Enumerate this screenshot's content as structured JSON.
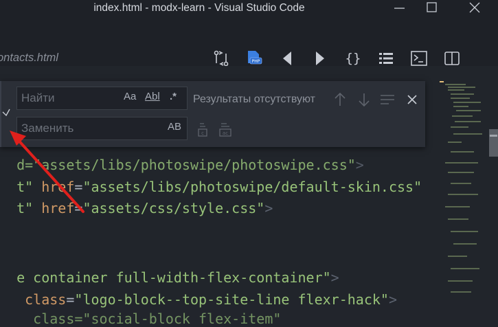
{
  "window": {
    "title": "index.html - modx-learn - Visual Studio Code"
  },
  "tab": {
    "label": "ontacts.html"
  },
  "toolbar": {
    "icons": [
      "compare-changes-icon",
      "php-icon",
      "previous-icon",
      "next-icon",
      "braces-icon",
      "list-icon",
      "terminal-icon",
      "split-editor-icon"
    ]
  },
  "find_widget": {
    "find_placeholder": "Найти",
    "replace_placeholder": "Заменить",
    "match_case": "Aa",
    "whole_word": "Abl",
    "regex": ".*",
    "preserve_case": "AB",
    "results": "Результаты отсутствуют"
  },
  "code_lines": [
    {
      "parts": [
        "t\" ",
        "href",
        "=",
        "\"assets/libs/photoswipe/default-skin.css\""
      ]
    },
    {
      "parts": [
        "t\" ",
        "href",
        "=",
        "\"assets/css/style.css\"",
        ">"
      ]
    },
    {
      "parts": [
        "e container full-width-flex-container\"",
        ">"
      ]
    },
    {
      "parts": [
        " ",
        "class",
        "=",
        "\"logo-block--top-site-line flexr-hack\"",
        ">"
      ]
    }
  ],
  "colors": {
    "background": "#21252b",
    "string": "#98c379",
    "attribute": "#d19a66",
    "arrow": "#e0201c"
  }
}
